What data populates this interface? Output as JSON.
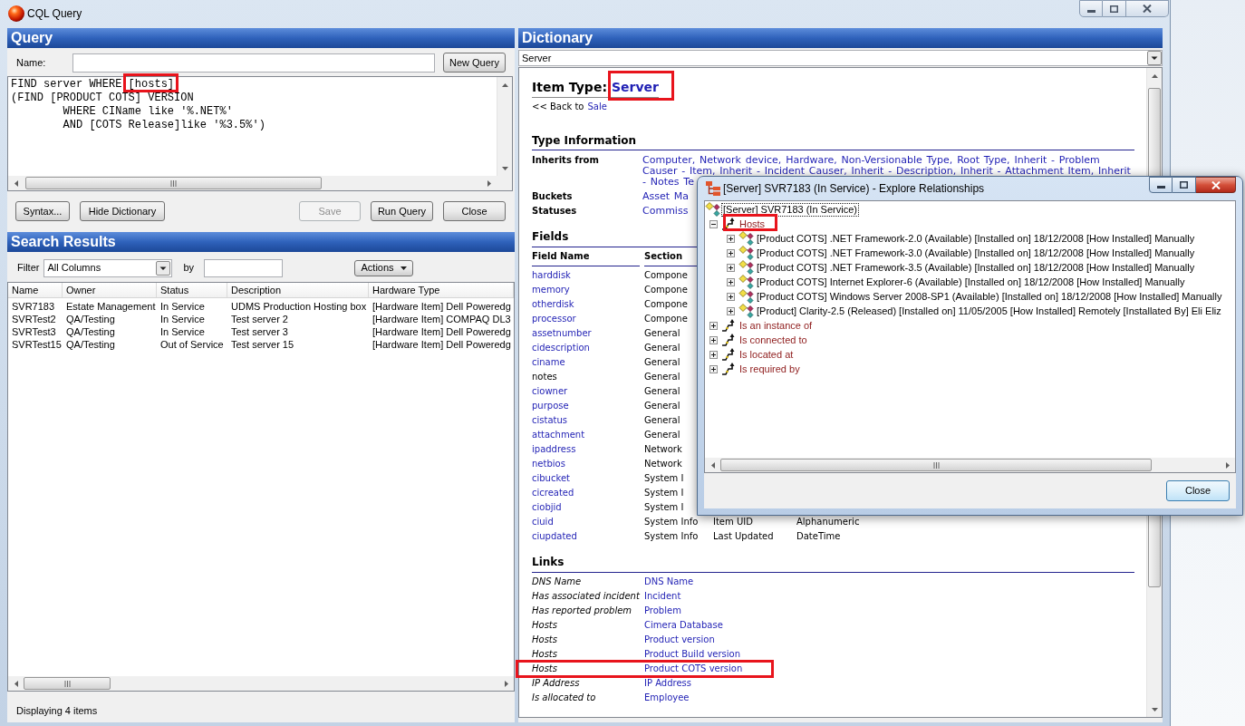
{
  "window": {
    "title": "CQL Query"
  },
  "query": {
    "title": "Query",
    "name_label": "Name:",
    "new_query_button": "New Query",
    "editor": {
      "lines": [
        "FIND server WHERE [hosts]",
        "(FIND [PRODUCT COTS] VERSION",
        "        WHERE CIName like '%.NET%'",
        "        AND [COTS Release]like '%3.5%')"
      ],
      "highlighted": true
    },
    "buttons": [
      {
        "label": "Syntax...",
        "disabled": false
      },
      {
        "label": "Hide Dictionary",
        "disabled": false
      },
      {
        "label": "Save",
        "disabled": true
      },
      {
        "label": "Run Query",
        "disabled": false
      },
      {
        "label": "Close",
        "disabled": false
      }
    ]
  },
  "search_results": {
    "title": "Search Results",
    "filter_label": "Filter",
    "filter_value": "All Columns",
    "by_label": "by",
    "actions_button": "Actions",
    "columns": [
      "Name",
      "Owner",
      "Status",
      "Description",
      "Hardware Type"
    ],
    "rows": [
      [
        "SVR7183",
        "Estate Management",
        "In Service",
        "UDMS Production Hosting box",
        "[Hardware Item] Dell Poweredg"
      ],
      [
        "SVRTest2",
        "QA/Testing",
        "In Service",
        "Test server 2",
        "[Hardware Item] COMPAQ DL3"
      ],
      [
        "SVRTest3",
        "QA/Testing",
        "In Service",
        "Test server 3",
        "[Hardware Item] Dell Poweredg"
      ],
      [
        "SVRTest15",
        "QA/Testing",
        "Out of Service",
        "Test server 15",
        "[Hardware Item] Dell Poweredg"
      ]
    ],
    "status": "Displaying 4 items"
  },
  "dictionary": {
    "title": "Dictionary",
    "type_select": "Server",
    "item_type": {
      "label": "Item Type:",
      "value": "Server",
      "highlighted": true
    },
    "back": {
      "text": "<< Back to",
      "link": "Sale"
    },
    "type_information": {
      "title": "Type Information",
      "rows": [
        {
          "label": "Inherits from",
          "value": "Computer, Network device, Hardware, Non-Versionable Type, Root Type, Inherit - Problem Causer - Item, Inherit - Incident Causer, Inherit - Description, Inherit - Attachment Item, Inherit - Notes Te"
        },
        {
          "label": "Buckets",
          "value": "Asset Ma"
        },
        {
          "label": "Statuses",
          "value": "Commiss"
        }
      ]
    },
    "fields": {
      "title": "Fields",
      "columns": [
        "Field Name",
        "Section"
      ],
      "rows": [
        {
          "name": "harddisk",
          "link": true,
          "section": "Compone"
        },
        {
          "name": "memory",
          "link": true,
          "section": "Compone"
        },
        {
          "name": "otherdisk",
          "link": true,
          "section": "Compone"
        },
        {
          "name": "processor",
          "link": true,
          "section": "Compone"
        },
        {
          "name": "assetnumber",
          "link": true,
          "section": "General"
        },
        {
          "name": "cidescription",
          "link": true,
          "section": "General"
        },
        {
          "name": "ciname",
          "link": true,
          "section": "General"
        },
        {
          "name": "notes",
          "link": false,
          "section": "General"
        },
        {
          "name": "ciowner",
          "link": true,
          "section": "General"
        },
        {
          "name": "purpose",
          "link": true,
          "section": "General"
        },
        {
          "name": "cistatus",
          "link": true,
          "section": "General"
        },
        {
          "name": "attachment",
          "link": true,
          "section": "General"
        },
        {
          "name": "ipaddress",
          "link": true,
          "section": "Network"
        },
        {
          "name": "netbios",
          "link": true,
          "section": "Network"
        },
        {
          "name": "cibucket",
          "link": true,
          "section": "System I"
        },
        {
          "name": "cicreated",
          "link": true,
          "section": "System I"
        },
        {
          "name": "ciobjid",
          "link": true,
          "section": "System I"
        },
        {
          "name": "ciuid",
          "link": true,
          "section": "System Info",
          "column_3": "Item UID",
          "column_4": "Alphanumeric"
        },
        {
          "name": "ciupdated",
          "link": true,
          "section": "System Info",
          "column_3": "Last Updated",
          "column_4": "DateTime"
        }
      ]
    },
    "links": {
      "title": "Links",
      "rows": [
        {
          "relation": "DNS Name",
          "target": "DNS Name",
          "highlighted": false
        },
        {
          "relation": "Has associated incident",
          "target": "Incident",
          "highlighted": false
        },
        {
          "relation": "Has reported problem",
          "target": "Problem",
          "highlighted": false
        },
        {
          "relation": "Hosts",
          "target": "Cimera Database",
          "highlighted": false
        },
        {
          "relation": "Hosts",
          "target": "Product version",
          "highlighted": false
        },
        {
          "relation": "Hosts",
          "target": "Product Build version",
          "highlighted": false
        },
        {
          "relation": "Hosts",
          "target": "Product COTS version",
          "highlighted": true
        },
        {
          "relation": "IP Address",
          "target": "IP Address",
          "highlighted": false
        },
        {
          "relation": "Is allocated to",
          "target": "Employee",
          "highlighted": false
        }
      ]
    }
  },
  "dialog": {
    "title": "[Server] SVR7183 (In Service) - Explore Relationships",
    "tree": [
      {
        "label": "[Server] SVR7183 (In Service)",
        "kind": "item",
        "selected": true,
        "highlighted": false,
        "children": [
          {
            "label": "Hosts",
            "kind": "relation",
            "expanded": true,
            "selected": false,
            "highlighted": true,
            "children": [
              {
                "label": "[Product COTS] .NET Framework-2.0 (Available) [Installed on] 18/12/2008 [How Installed] Manually",
                "kind": "item",
                "expanded": false,
                "selected": false,
                "highlighted": false
              },
              {
                "label": "[Product COTS] .NET Framework-3.0 (Available) [Installed on] 18/12/2008 [How Installed] Manually",
                "kind": "item",
                "expanded": false,
                "selected": false,
                "highlighted": false
              },
              {
                "label": "[Product COTS] .NET Framework-3.5 (Available) [Installed on] 18/12/2008 [How Installed] Manually",
                "kind": "item",
                "expanded": false,
                "selected": false,
                "highlighted": false
              },
              {
                "label": "[Product COTS] Internet Explorer-6 (Available) [Installed on] 18/12/2008 [How Installed] Manually",
                "kind": "item",
                "expanded": false,
                "selected": false,
                "highlighted": false
              },
              {
                "label": "[Product COTS] Windows Server 2008-SP1 (Available) [Installed on] 18/12/2008 [How Installed] Manually",
                "kind": "item",
                "expanded": false,
                "selected": false,
                "highlighted": false
              },
              {
                "label": "[Product] Clarity-2.5 (Released) [Installed on] 11/05/2005 [How Installed] Remotely [Installated By] Eli Eliz",
                "kind": "item",
                "expanded": false,
                "selected": false,
                "highlighted": false
              }
            ]
          },
          {
            "label": "Is an instance of",
            "kind": "relation",
            "expanded": false,
            "selected": false,
            "highlighted": false
          },
          {
            "label": "Is connected to",
            "kind": "relation",
            "expanded": false,
            "selected": false,
            "highlighted": false
          },
          {
            "label": "Is located at",
            "kind": "relation",
            "expanded": false,
            "selected": false,
            "highlighted": false
          },
          {
            "label": "Is required by",
            "kind": "relation",
            "expanded": false,
            "selected": false,
            "highlighted": false
          }
        ]
      }
    ],
    "close_button": "Close"
  }
}
